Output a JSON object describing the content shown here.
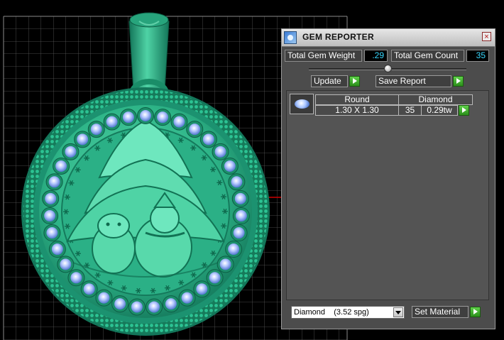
{
  "panel": {
    "title": "GEM REPORTER",
    "close_label": "×",
    "total_gem_weight_label": "Total Gem Weight",
    "total_gem_weight_value": ".29",
    "total_gem_count_label": "Total Gem Count",
    "total_gem_count_value": "35",
    "update_label": "Update",
    "save_report_label": "Save Report",
    "columns": [
      "Round",
      "Diamond"
    ],
    "rows": [
      {
        "shape": "Round",
        "size": "1.30 X 1.30",
        "count": "35",
        "weight": "0.29tw",
        "material": "Diamond"
      }
    ],
    "material_select": "Diamond    (3.52 spg)",
    "set_material_label": "Set Material"
  },
  "colors": {
    "metal": "#1fa37a",
    "gem": "#b7c9ff",
    "panel_bg": "#4c4c4c",
    "value_text": "#38d8ff",
    "go_button": "#3fbf2a",
    "axis_red": "#cc0000"
  }
}
